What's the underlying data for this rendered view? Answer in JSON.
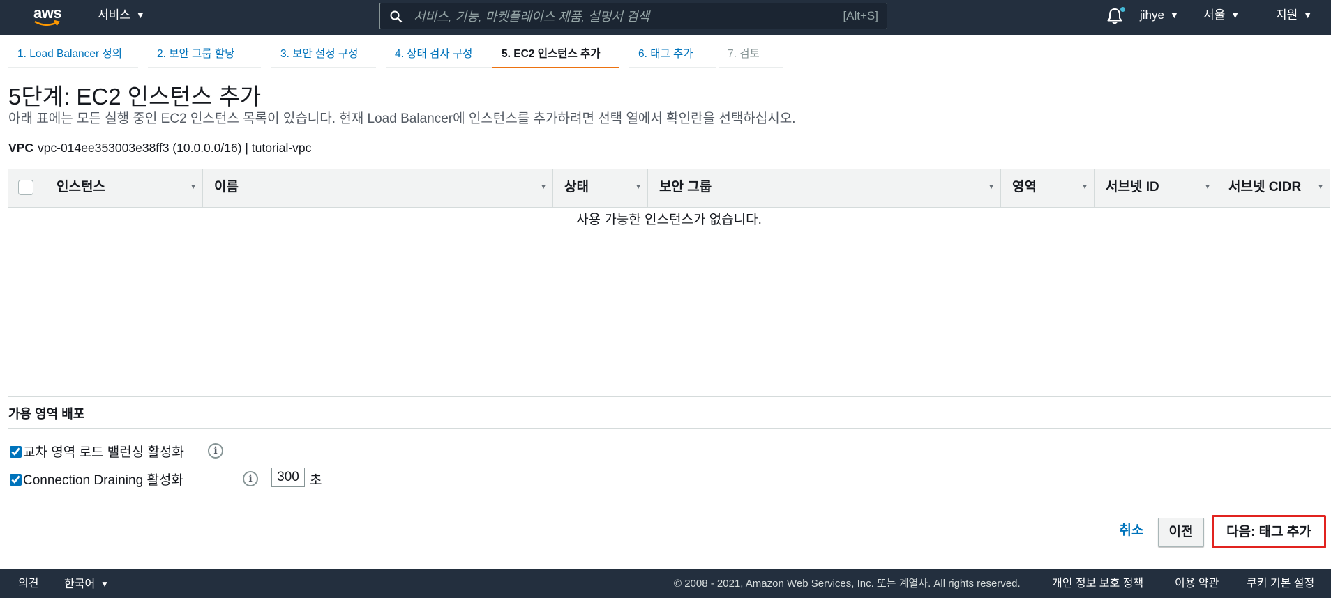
{
  "topnav": {
    "logo_text": "aws",
    "services_label": "서비스",
    "search_placeholder": "서비스, 기능, 마켓플레이스 제품, 설명서 검색",
    "search_shortcut": "[Alt+S]",
    "user_label": "jihye",
    "region_label": "서울",
    "support_label": "지원"
  },
  "steps": [
    {
      "label": "1. Load Balancer 정의"
    },
    {
      "label": "2. 보안 그룹 할당"
    },
    {
      "label": "3. 보안 설정 구성"
    },
    {
      "label": "4. 상태 검사 구성"
    },
    {
      "label": "5. EC2 인스턴스 추가"
    },
    {
      "label": "6. 태그 추가"
    },
    {
      "label": "7. 검토"
    }
  ],
  "active_step": 5,
  "page": {
    "title": "5단계: EC2 인스턴스 추가",
    "description": "아래 표에는 모든 실행 중인 EC2 인스턴스 목록이 있습니다. 현재 Load Balancer에 인스턴스를 추가하려면 선택 열에서 확인란을 선택하십시오.",
    "vpc_label": "VPC",
    "vpc_value": "vpc-014ee353003e38ff3 (10.0.0.0/16) | tutorial-vpc"
  },
  "table": {
    "columns": [
      "인스턴스",
      "이름",
      "상태",
      "보안 그룹",
      "영역",
      "서브넷 ID",
      "서브넷 CIDR"
    ],
    "empty_message": "사용 가능한 인스턴스가 없습니다."
  },
  "az_section": {
    "title": "가용 영역 배포",
    "cross_zone_label": "교차 영역 로드 밸런싱 활성화",
    "cross_zone_checked": true,
    "draining_label": "Connection Draining 활성화",
    "draining_checked": true,
    "draining_timeout": "300",
    "draining_unit": "초"
  },
  "actions": {
    "cancel": "취소",
    "previous": "이전",
    "next": "다음: 태그 추가"
  },
  "footer": {
    "feedback": "의견",
    "language": "한국어",
    "copyright": "© 2008 - 2021, Amazon Web Services, Inc. 또는 계열사. All rights reserved.",
    "privacy": "개인 정보 보호 정책",
    "terms": "이용 약관",
    "cookies": "쿠키 기본 설정"
  },
  "colors": {
    "nav_bg": "#232f3e",
    "link": "#0073bb",
    "active_tab": "#ec7211",
    "highlight": "#e1231f"
  }
}
